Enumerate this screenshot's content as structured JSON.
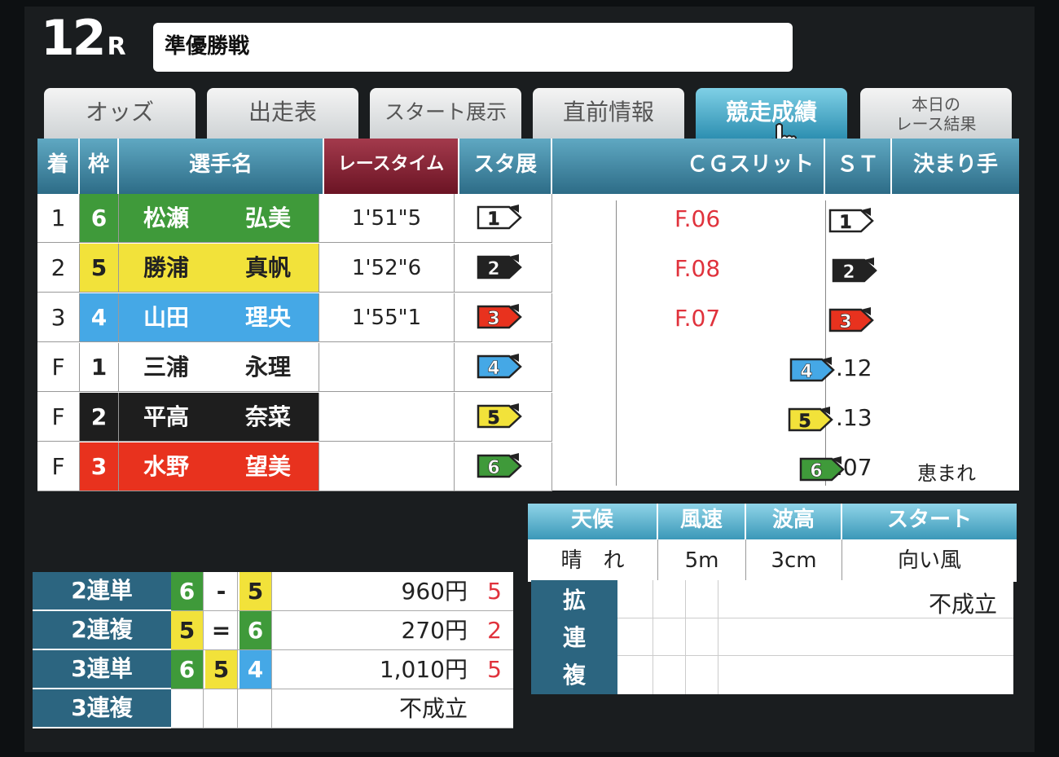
{
  "header": {
    "race_number": "12",
    "race_suffix": "R",
    "race_title": "準優勝戦"
  },
  "tabs": [
    {
      "label": "オッズ",
      "active": false
    },
    {
      "label": "出走表",
      "active": false
    },
    {
      "label": "スタート展示",
      "active": false
    },
    {
      "label": "直前情報",
      "active": false
    },
    {
      "label": "競走成績",
      "active": true
    },
    {
      "label_line1": "本日の",
      "label_line2": "レース結果",
      "active": false
    }
  ],
  "results_table": {
    "headers": {
      "position": "着",
      "frame": "枠",
      "name": "選手名",
      "race_time": "レースタイム",
      "start_exhibition": "スタ展",
      "cg_slit": "ＣＧスリット",
      "st": "ＳＴ",
      "kimarite": "決まり手"
    },
    "rows": [
      {
        "position": "1",
        "frame": "6",
        "last_name": "松瀬",
        "first_name": "弘美",
        "time": "1'51\"5",
        "ex_boat": "1",
        "slit_boat": "1",
        "slit_time": "F.06",
        "st": "",
        "kimarite": "",
        "bg": "#3f9a3a",
        "fg": "#ffffff"
      },
      {
        "position": "2",
        "frame": "5",
        "last_name": "勝浦",
        "first_name": "真帆",
        "time": "1'52\"6",
        "ex_boat": "2",
        "slit_boat": "2",
        "slit_time": "F.08",
        "st": "",
        "kimarite": "",
        "bg": "#f2e23a",
        "fg": "#222222"
      },
      {
        "position": "3",
        "frame": "4",
        "last_name": "山田",
        "first_name": "理央",
        "time": "1'55\"1",
        "ex_boat": "3",
        "slit_boat": "3",
        "slit_time": "F.07",
        "st": "",
        "kimarite": "",
        "bg": "#45a8e6",
        "fg": "#ffffff"
      },
      {
        "position": "F",
        "frame": "1",
        "last_name": "三浦",
        "first_name": "永理",
        "time": "",
        "ex_boat": "4",
        "slit_boat": "4",
        "slit_time": "",
        "st": ".12",
        "kimarite": "",
        "bg": "#ffffff",
        "fg": "#222222"
      },
      {
        "position": "F",
        "frame": "2",
        "last_name": "平高",
        "first_name": "奈菜",
        "time": "",
        "ex_boat": "5",
        "slit_boat": "5",
        "slit_time": "",
        "st": ".13",
        "kimarite": "",
        "bg": "#1e1e1e",
        "fg": "#ffffff"
      },
      {
        "position": "F",
        "frame": "3",
        "last_name": "水野",
        "first_name": "望美",
        "time": "",
        "ex_boat": "6",
        "slit_boat": "6",
        "slit_time": "",
        "st": ".07",
        "kimarite": "恵まれ",
        "bg": "#e8321e",
        "fg": "#ffffff"
      }
    ]
  },
  "boat_colors": {
    "1": {
      "fill": "#ffffff",
      "text": "#222222"
    },
    "2": {
      "fill": "#222222",
      "text": "#ffffff"
    },
    "3": {
      "fill": "#e8321e",
      "text": "#ffffff"
    },
    "4": {
      "fill": "#45a8e6",
      "text": "#ffffff"
    },
    "5": {
      "fill": "#f2e23a",
      "text": "#222222"
    },
    "6": {
      "fill": "#3f9a3a",
      "text": "#ffffff"
    }
  },
  "weather": {
    "headers": [
      "天候",
      "風速",
      "波高",
      "スタート"
    ],
    "values": [
      "晴　れ",
      "5m",
      "3cm",
      "向い風"
    ]
  },
  "kakurenpuku": {
    "label_chars": [
      "拡",
      "連",
      "複"
    ],
    "value": "不成立"
  },
  "payouts": [
    {
      "label": "2連単",
      "boxes": [
        {
          "v": "6",
          "bg": "#3f9a3a",
          "fg": "#ffffff"
        },
        {
          "v": "-",
          "bg": "#ffffff",
          "fg": "#222222"
        },
        {
          "v": "5",
          "bg": "#f2e23a",
          "fg": "#222222"
        }
      ],
      "amount": "960円",
      "popularity": "5"
    },
    {
      "label": "2連複",
      "boxes": [
        {
          "v": "5",
          "bg": "#f2e23a",
          "fg": "#222222"
        },
        {
          "v": "=",
          "bg": "#ffffff",
          "fg": "#222222"
        },
        {
          "v": "6",
          "bg": "#3f9a3a",
          "fg": "#ffffff"
        }
      ],
      "amount": "270円",
      "popularity": "2"
    },
    {
      "label": "3連単",
      "boxes": [
        {
          "v": "6",
          "bg": "#3f9a3a",
          "fg": "#ffffff"
        },
        {
          "v": "5",
          "bg": "#f2e23a",
          "fg": "#222222"
        },
        {
          "v": "4",
          "bg": "#45a8e6",
          "fg": "#ffffff"
        }
      ],
      "amount": "1,010円",
      "popularity": "5"
    },
    {
      "label": "3連複",
      "boxes": [
        {
          "v": "",
          "bg": "#ffffff",
          "fg": "#222222"
        },
        {
          "v": "",
          "bg": "#ffffff",
          "fg": "#222222"
        },
        {
          "v": "",
          "bg": "#ffffff",
          "fg": "#222222"
        }
      ],
      "amount": "不成立",
      "popularity": ""
    }
  ],
  "accent_color": "#2d8fb1",
  "icons": {
    "cursor": "hand-pointer-icon"
  }
}
